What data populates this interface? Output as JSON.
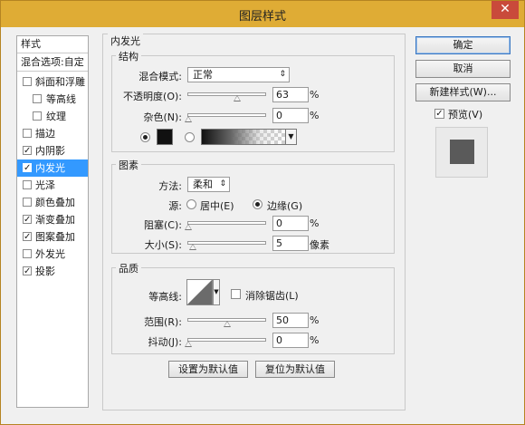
{
  "window": {
    "title": "图层样式",
    "close_label": "✕"
  },
  "sidebar": {
    "header": "样式",
    "blend": "混合选项:自定",
    "items": [
      {
        "label": "斜面和浮雕",
        "checked": false,
        "mark": ""
      },
      {
        "label": "等高线",
        "checked": false,
        "mark": ""
      },
      {
        "label": "纹理",
        "checked": false,
        "mark": ""
      },
      {
        "label": "描边",
        "checked": false,
        "mark": ""
      },
      {
        "label": "内阴影",
        "checked": true,
        "mark": "✓"
      },
      {
        "label": "内发光",
        "checked": true,
        "mark": "✓"
      },
      {
        "label": "光泽",
        "checked": false,
        "mark": ""
      },
      {
        "label": "颜色叠加",
        "checked": false,
        "mark": ""
      },
      {
        "label": "渐变叠加",
        "checked": true,
        "mark": "✓"
      },
      {
        "label": "图案叠加",
        "checked": true,
        "mark": "✓"
      },
      {
        "label": "外发光",
        "checked": false,
        "mark": ""
      },
      {
        "label": "投影",
        "checked": true,
        "mark": "✓"
      }
    ]
  },
  "panel": {
    "title": "内发光",
    "structure": {
      "title": "结构",
      "blend_mode_label": "混合模式:",
      "blend_mode_value": "正常",
      "opacity_label": "不透明度(O):",
      "opacity_value": "63",
      "opacity_unit": "%",
      "noise_label": "杂色(N):",
      "noise_value": "0",
      "noise_unit": "%"
    },
    "elements": {
      "title": "图素",
      "method_label": "方法:",
      "method_value": "柔和",
      "source_label": "源:",
      "source_center": "居中(E)",
      "source_edge": "边缘(G)",
      "choke_label": "阻塞(C):",
      "choke_value": "0",
      "choke_unit": "%",
      "size_label": "大小(S):",
      "size_value": "5",
      "size_unit": "像素"
    },
    "quality": {
      "title": "品质",
      "contour_label": "等高线:",
      "antialias_label": "消除锯齿(L)",
      "range_label": "范围(R):",
      "range_value": "50",
      "range_unit": "%",
      "jitter_label": "抖动(J):",
      "jitter_value": "0",
      "jitter_unit": "%"
    },
    "set_default": "设置为默认值",
    "reset_default": "复位为默认值"
  },
  "actions": {
    "ok": "确定",
    "cancel": "取消",
    "new_style": "新建样式(W)...",
    "preview_label": "预览(V)",
    "preview_mark": "✓"
  },
  "colors": {
    "accent": "#3399ff",
    "titlebar": "#dfac35",
    "close": "#c94a3b",
    "glow_color": "#111111",
    "preview_swatch": "#5a5a5a"
  }
}
